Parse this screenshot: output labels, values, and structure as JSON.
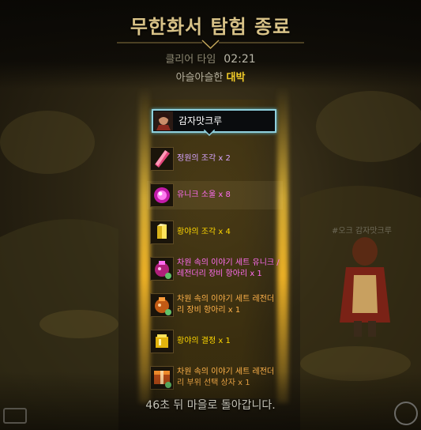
{
  "header": {
    "title": "무한화서 탐험 종료",
    "clear_label": "클리어 타임",
    "clear_time": "02:21",
    "grade_prefix": "아슬아슬한",
    "grade": "대박"
  },
  "player": {
    "name": "감자맛크루",
    "background_name": "#오크 감자맛크루"
  },
  "rewards": [
    {
      "text": "정원의 조각  x 2",
      "color": "#d6a4ff",
      "icon": "pink-shard-icon"
    },
    {
      "text": "유니크 소울  x 8",
      "color": "#ff6df0",
      "icon": "unique-soul-icon"
    },
    {
      "text": "황야의 조각  x 4",
      "color": "#ffd700",
      "icon": "yellow-shard-icon"
    },
    {
      "text": "차원 속의 이야기 세트 유니크 /레전더리 장비 항아리 x 1",
      "color": "#ff6df0",
      "icon": "unique-jar-icon"
    },
    {
      "text": "차원 속의 이야기 세트 레전더리 장비 항아리 x 1",
      "color": "#ffb24a",
      "icon": "legendary-jar-icon"
    },
    {
      "text": "황야의 결정  x 1",
      "color": "#ffd700",
      "icon": "yellow-crystal-icon"
    },
    {
      "text": "차원 속의 이야기 세트 레전더리 부위 선택 상자 x 1",
      "color": "#ffb24a",
      "icon": "legendary-box-icon"
    }
  ],
  "footer": {
    "message": "46초 뒤 마을로 돌아갑니다."
  }
}
